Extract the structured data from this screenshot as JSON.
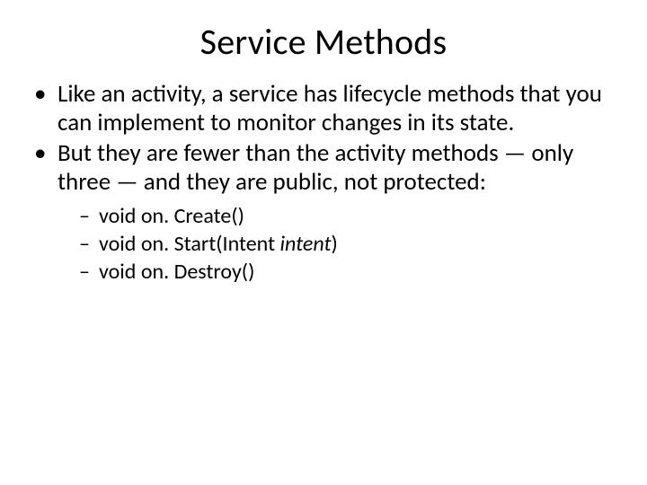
{
  "title": "Service Methods",
  "bullets": [
    "Like an activity, a service has lifecycle methods that you can implement to monitor changes in its state.",
    "But they are fewer than the activity methods — only three — and they are public, not protected:"
  ],
  "sub": {
    "m0_pre": "void on. Create()",
    "m1_pre": "void on. Start(Intent ",
    "m1_it": "intent",
    "m1_post": ")",
    "m2_pre": "void on. Destroy()"
  }
}
